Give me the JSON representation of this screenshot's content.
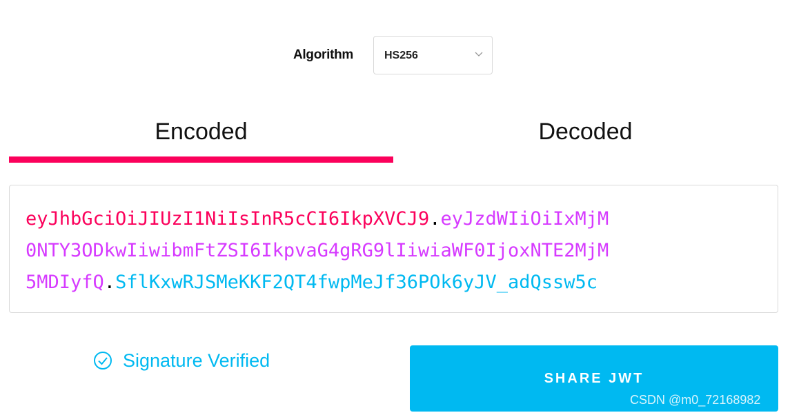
{
  "algorithm": {
    "label": "Algorithm",
    "selected": "HS256"
  },
  "tabs": [
    {
      "label": "Encoded"
    },
    {
      "label": "Decoded"
    }
  ],
  "token": {
    "header": "eyJhbGciOiJIUzI1NiIsInR5cCI6IkpXVCJ9",
    "payload_line1": "eyJzdWIiOiIxMjM",
    "payload_line2": "0NTY3ODkwIiwibmFtZSI6IkpvaG4gRG9lIiwiaWF0IjoxNTE2MjM",
    "payload_line3": "5MDIyfQ",
    "signature": "SflKxwRJSMeKKF2QT4fwpMeJf36POk6yJV_adQssw5c",
    "dot": "."
  },
  "status": {
    "text": "Signature Verified"
  },
  "share_button": {
    "label": "SHARE JWT"
  },
  "watermark": "CSDN @m0_72168982",
  "colors": {
    "header": "#fb015b",
    "payload": "#d63aff",
    "signature": "#00b9f1",
    "accent": "#00b9f1"
  }
}
